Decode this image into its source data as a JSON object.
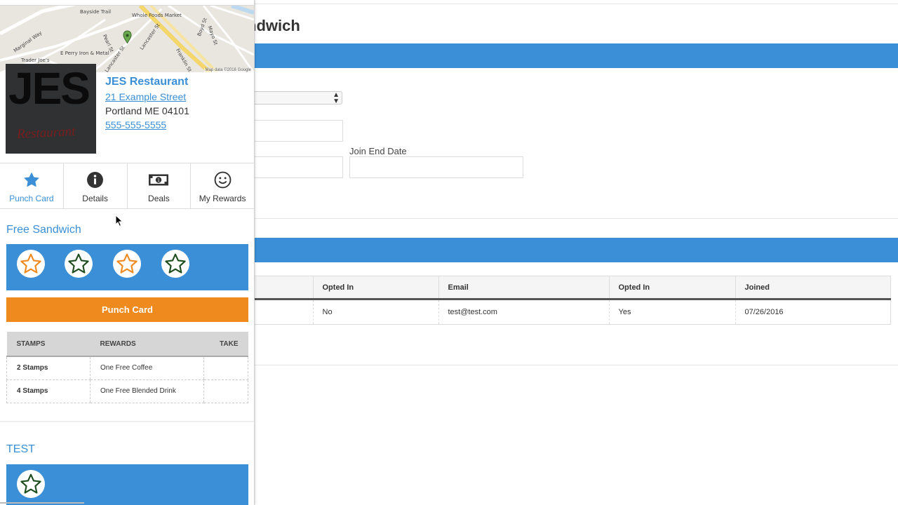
{
  "colors": {
    "accent": "#3a8fd6",
    "orange": "#ef8a1f",
    "star_orange": "#ef8a1f",
    "star_green": "#1e4d1e"
  },
  "admin": {
    "page_title": "ndwich",
    "join_end_label": "Join End Date",
    "subscribers_table": {
      "headers": [
        "",
        "Opted In",
        "Email",
        "Opted In",
        "Joined"
      ],
      "rows": [
        [
          "",
          "No",
          "test@test.com",
          "Yes",
          "07/26/2016"
        ]
      ]
    }
  },
  "map": {
    "labels": [
      "Bayside Trail",
      "Whole Foods Market",
      "Marginal Way",
      "Pearl St",
      "Lancaster St",
      "Boyd St",
      "Mayo St",
      "E Perry Iron & Metal",
      "Trader Joe's",
      "Franklin St",
      "Lancaster St",
      "Map data ©2016 Google"
    ]
  },
  "business": {
    "logo_text": "JES",
    "logo_script": "Restaurant",
    "name": "JES Restaurant",
    "street": "21 Example Street",
    "city": "Portland ME 04101",
    "phone": "555-555-5555"
  },
  "tabs": [
    {
      "label": "Punch Card",
      "icon": "star-icon",
      "active": true
    },
    {
      "label": "Details",
      "icon": "info-icon",
      "active": false
    },
    {
      "label": "Deals",
      "icon": "money-icon",
      "active": false
    },
    {
      "label": "My Rewards",
      "icon": "smiley-icon",
      "active": false
    }
  ],
  "punch_cards": [
    {
      "title": "Free Sandwich",
      "stamps": [
        "orange",
        "green",
        "orange",
        "green"
      ],
      "button": "Punch Card",
      "rewards_headers": [
        "STAMPS",
        "REWARDS",
        "TAKE"
      ],
      "rewards": [
        {
          "stamps": "2 Stamps",
          "reward": "One Free Coffee",
          "take": ""
        },
        {
          "stamps": "4 Stamps",
          "reward": "One Free Blended Drink",
          "take": ""
        }
      ]
    },
    {
      "title": "TEST",
      "stamps": [
        "green"
      ]
    }
  ]
}
